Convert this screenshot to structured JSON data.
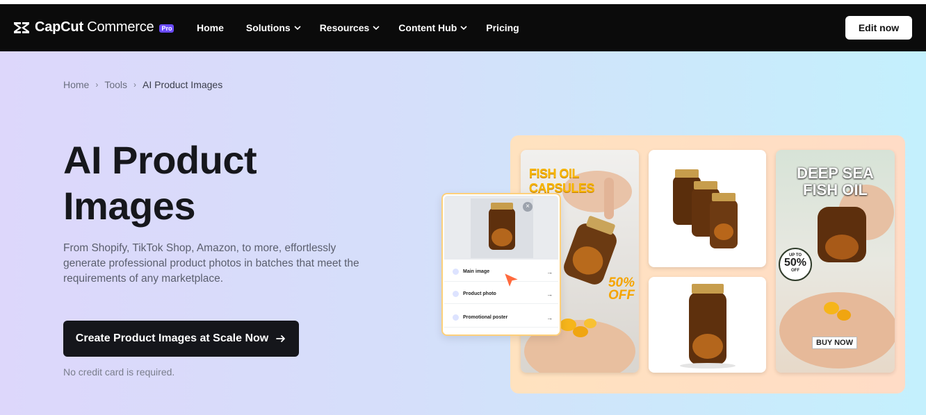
{
  "brand": {
    "name_bold": "CapCut",
    "name_regular": " Commerce",
    "badge": "Pro"
  },
  "nav": {
    "items": [
      {
        "label": "Home",
        "has_dropdown": false
      },
      {
        "label": "Solutions",
        "has_dropdown": true
      },
      {
        "label": "Resources",
        "has_dropdown": true
      },
      {
        "label": "Content Hub",
        "has_dropdown": true
      },
      {
        "label": "Pricing",
        "has_dropdown": false
      }
    ],
    "edit_button": "Edit now"
  },
  "breadcrumb": {
    "items": [
      "Home",
      "Tools"
    ],
    "current": "AI Product Images"
  },
  "hero": {
    "title": "AI Product Images",
    "description": "From Shopify, TikTok Shop, Amazon, to more, effortlessly generate professional product photos in batches that meet the requirements of any marketplace.",
    "cta_label": "Create Product Images at Scale Now",
    "note": "No credit card is required."
  },
  "showcase": {
    "card1_title": "FISH OIL CAPSULES",
    "card1_offer_line1": "50%",
    "card1_offer_line2": "OFF",
    "card4_title_line1": "DEEP SEA",
    "card4_title_line2": "FISH OIL",
    "card4_badge_top": "UP TO",
    "card4_badge_pct": "50%",
    "card4_badge_bottom": "OFF",
    "card4_button": "BUY NOW",
    "panel_options": [
      "Main image",
      "Product photo",
      "Promotional poster"
    ]
  },
  "colors": {
    "navbar_bg": "#0b0b0b",
    "cta_bg": "#15161b",
    "pro_badge": "#6a4bff",
    "showcase_bg": "#ffe2bf",
    "cursor": "#ff6a3d"
  }
}
